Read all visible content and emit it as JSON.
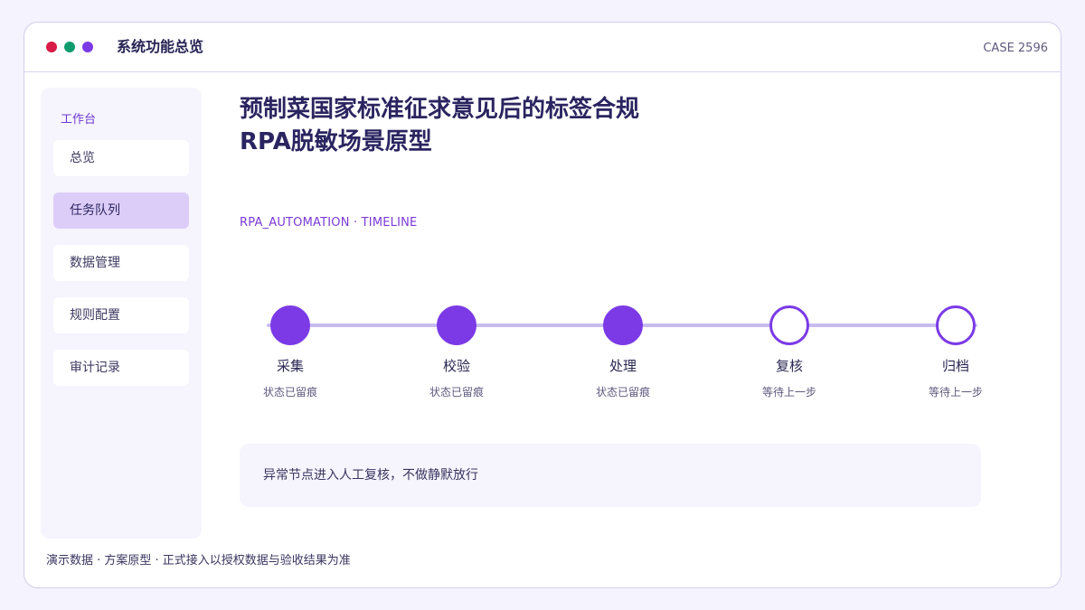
{
  "window": {
    "title": "系统功能总览",
    "case_id": "CASE 2596",
    "colors": {
      "red": "#d81b48",
      "green": "#0f9b6e",
      "purple": "#7b3ae6"
    }
  },
  "sidebar": {
    "heading": "工作台",
    "items": [
      {
        "label": "总览"
      },
      {
        "label": "任务队列",
        "active": true
      },
      {
        "label": "数据管理"
      },
      {
        "label": "规则配置"
      },
      {
        "label": "审计记录"
      }
    ]
  },
  "main": {
    "title_line1": "预制菜国家标准征求意见后的标签合规",
    "title_line2": "RPA脱敏场景原型",
    "subtitle": "RPA_AUTOMATION · TIMELINE",
    "timeline": [
      {
        "label": "采集",
        "status": "状态已留痕",
        "state": "done"
      },
      {
        "label": "校验",
        "status": "状态已留痕",
        "state": "done"
      },
      {
        "label": "处理",
        "status": "状态已留痕",
        "state": "done"
      },
      {
        "label": "复核",
        "status": "等待上一步",
        "state": "pending"
      },
      {
        "label": "归档",
        "status": "等待上一步",
        "state": "pending"
      }
    ],
    "notice": "异常节点进入人工复核，不做静默放行"
  },
  "footer": "演示数据 · 方案原型 · 正式接入以授权数据与验收结果为准"
}
